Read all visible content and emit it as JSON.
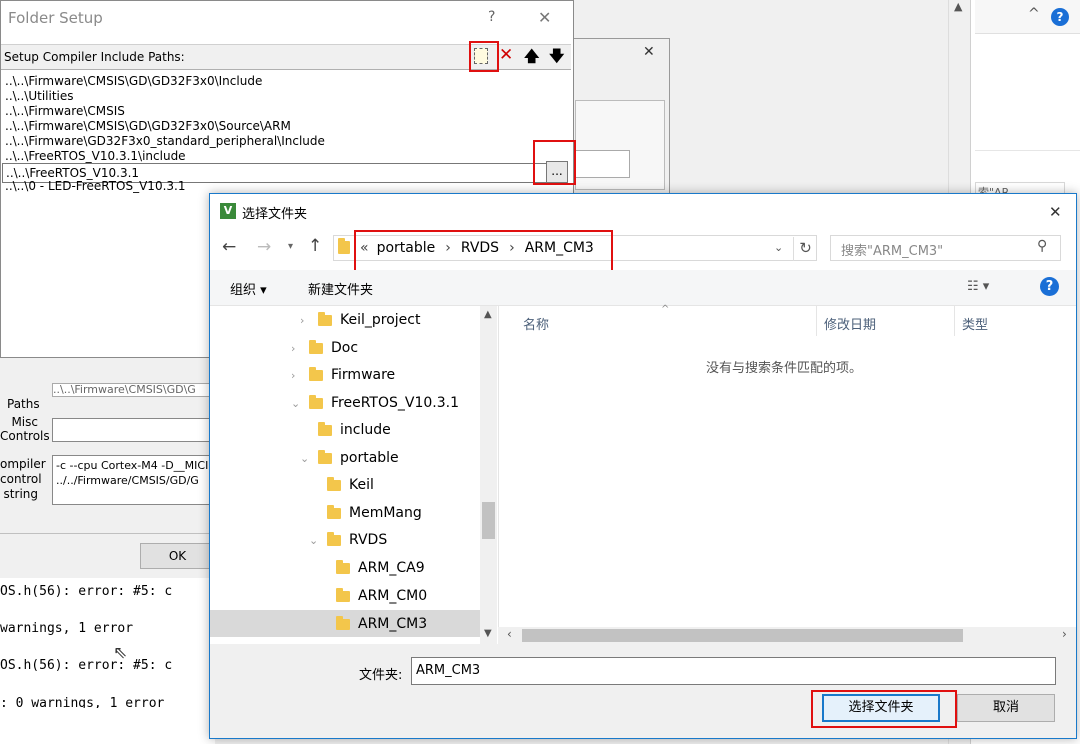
{
  "folder_setup": {
    "title": "Folder Setup",
    "help_glyph": "?",
    "close_glyph": "✕",
    "header_label": "Setup Compiler Include Paths:",
    "paths": [
      "..\\..\\Firmware\\CMSIS\\GD\\GD32F3x0\\Include",
      "..\\..\\Utilities",
      "..\\..\\Firmware\\CMSIS",
      "..\\..\\Firmware\\CMSIS\\GD\\GD32F3x0\\Source\\ARM",
      "..\\..\\Firmware\\GD32F3x0_standard_peripheral\\Include",
      "..\\..\\FreeRTOS_V10.3.1\\include"
    ],
    "edit_value": "..\\..\\FreeRTOS_V10.3.1",
    "browse_label": "...",
    "last_path": "..\\..\\0 - LED-FreeRTOS_V10.3.1"
  },
  "options": {
    "paths_label": "Paths",
    "paths_value": "..\\..\\Firmware\\CMSIS\\GD\\G",
    "misc_label_1": "Misc",
    "misc_label_2": "Controls",
    "compiler_label_1": "ompiler",
    "compiler_label_2": "control",
    "compiler_label_3": "string",
    "compiler_line_1": "-c --cpu Cortex-M4 -D__MICI",
    "compiler_line_2": "../../Firmware/CMSIS/GD/G",
    "ok_label": "OK"
  },
  "build_output": {
    "lines": [
      "OS.h(56): error:  #5: c",
      "warnings, 1 error",
      "OS.h(56): error:  #5: c",
      ": 0 warnings, 1 error"
    ]
  },
  "right_panel": {
    "up_glyph": "^",
    "help_glyph": "?",
    "search_snippet": "索\"AR"
  },
  "dialog": {
    "title": "选择文件夹",
    "app_icon_letter": "V",
    "close_glyph": "✕",
    "breadcrumb": {
      "prefix": "«",
      "items": [
        "portable",
        "RVDS",
        "ARM_CM3"
      ],
      "separator": "›"
    },
    "search_placeholder": "搜索\"ARM_CM3\"",
    "toolbar": {
      "organize": "组织 ▾",
      "new_folder": "新建文件夹"
    },
    "tree": [
      {
        "label": "Keil_project",
        "chev": "›"
      },
      {
        "label": "Doc",
        "chev": "›"
      },
      {
        "label": "Firmware",
        "chev": "›"
      },
      {
        "label": "FreeRTOS_V10.3.1",
        "chev": "⌄"
      },
      {
        "label": "include",
        "chev": ""
      },
      {
        "label": "portable",
        "chev": "⌄"
      },
      {
        "label": "Keil",
        "chev": ""
      },
      {
        "label": "MemMang",
        "chev": ""
      },
      {
        "label": "RVDS",
        "chev": "⌄"
      },
      {
        "label": "ARM_CA9",
        "chev": ""
      },
      {
        "label": "ARM_CM0",
        "chev": ""
      },
      {
        "label": "ARM_CM3",
        "chev": ""
      }
    ],
    "columns": {
      "name": "名称",
      "modified": "修改日期",
      "type": "类型"
    },
    "empty_message": "没有与搜索条件匹配的项。",
    "folder_label": "文件夹:",
    "folder_value": "ARM_CM3",
    "select_button": "选择文件夹",
    "cancel_button": "取消"
  }
}
